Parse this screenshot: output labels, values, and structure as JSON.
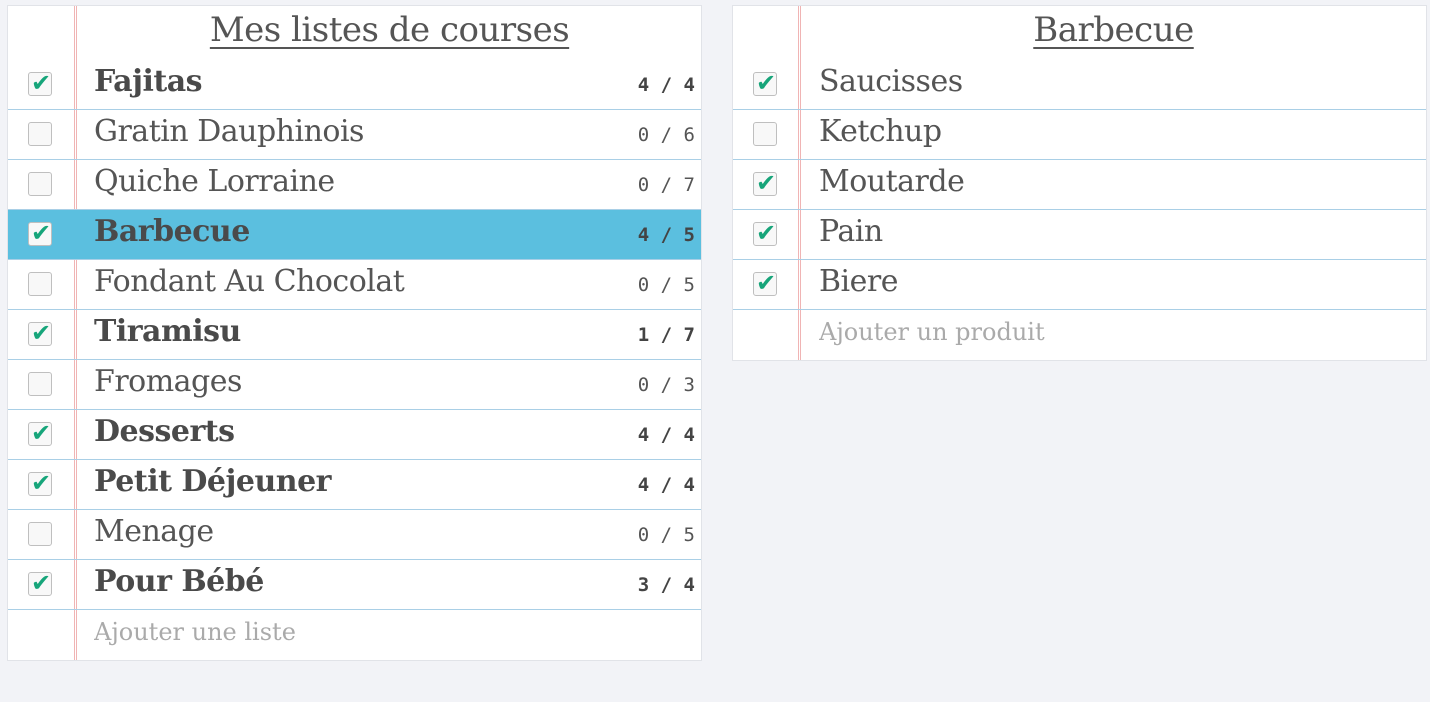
{
  "lists_panel": {
    "title": "Mes listes de courses",
    "lists": [
      {
        "name": "Fajitas",
        "checked": true,
        "count": "4 / 4",
        "selected": false
      },
      {
        "name": "Gratin Dauphinois",
        "checked": false,
        "count": "0 / 6",
        "selected": false
      },
      {
        "name": "Quiche Lorraine",
        "checked": false,
        "count": "0 / 7",
        "selected": false
      },
      {
        "name": "Barbecue",
        "checked": true,
        "count": "4 / 5",
        "selected": true
      },
      {
        "name": "Fondant Au Chocolat",
        "checked": false,
        "count": "0 / 5",
        "selected": false
      },
      {
        "name": "Tiramisu",
        "checked": true,
        "count": "1 / 7",
        "selected": false
      },
      {
        "name": "Fromages",
        "checked": false,
        "count": "0 / 3",
        "selected": false
      },
      {
        "name": "Desserts",
        "checked": true,
        "count": "4 / 4",
        "selected": false
      },
      {
        "name": "Petit Déjeuner",
        "checked": true,
        "count": "4 / 4",
        "selected": false
      },
      {
        "name": "Menage",
        "checked": false,
        "count": "0 / 5",
        "selected": false
      },
      {
        "name": "Pour Bébé",
        "checked": true,
        "count": "3 / 4",
        "selected": false
      }
    ],
    "add_placeholder": "Ajouter une liste"
  },
  "items_panel": {
    "title": "Barbecue",
    "items": [
      {
        "name": "Saucisses",
        "checked": true
      },
      {
        "name": "Ketchup",
        "checked": false
      },
      {
        "name": "Moutarde",
        "checked": true
      },
      {
        "name": "Pain",
        "checked": true
      },
      {
        "name": "Biere",
        "checked": true
      }
    ],
    "add_placeholder": "Ajouter un produit"
  },
  "colors": {
    "selected_row": "#5bbfdf",
    "check_tick": "#17a57a",
    "margin_line": "#f0b4b4",
    "rule_line": "#a9cfe6",
    "background": "#f2f3f7"
  },
  "icons": {
    "check_mark": "check-mark-icon"
  }
}
